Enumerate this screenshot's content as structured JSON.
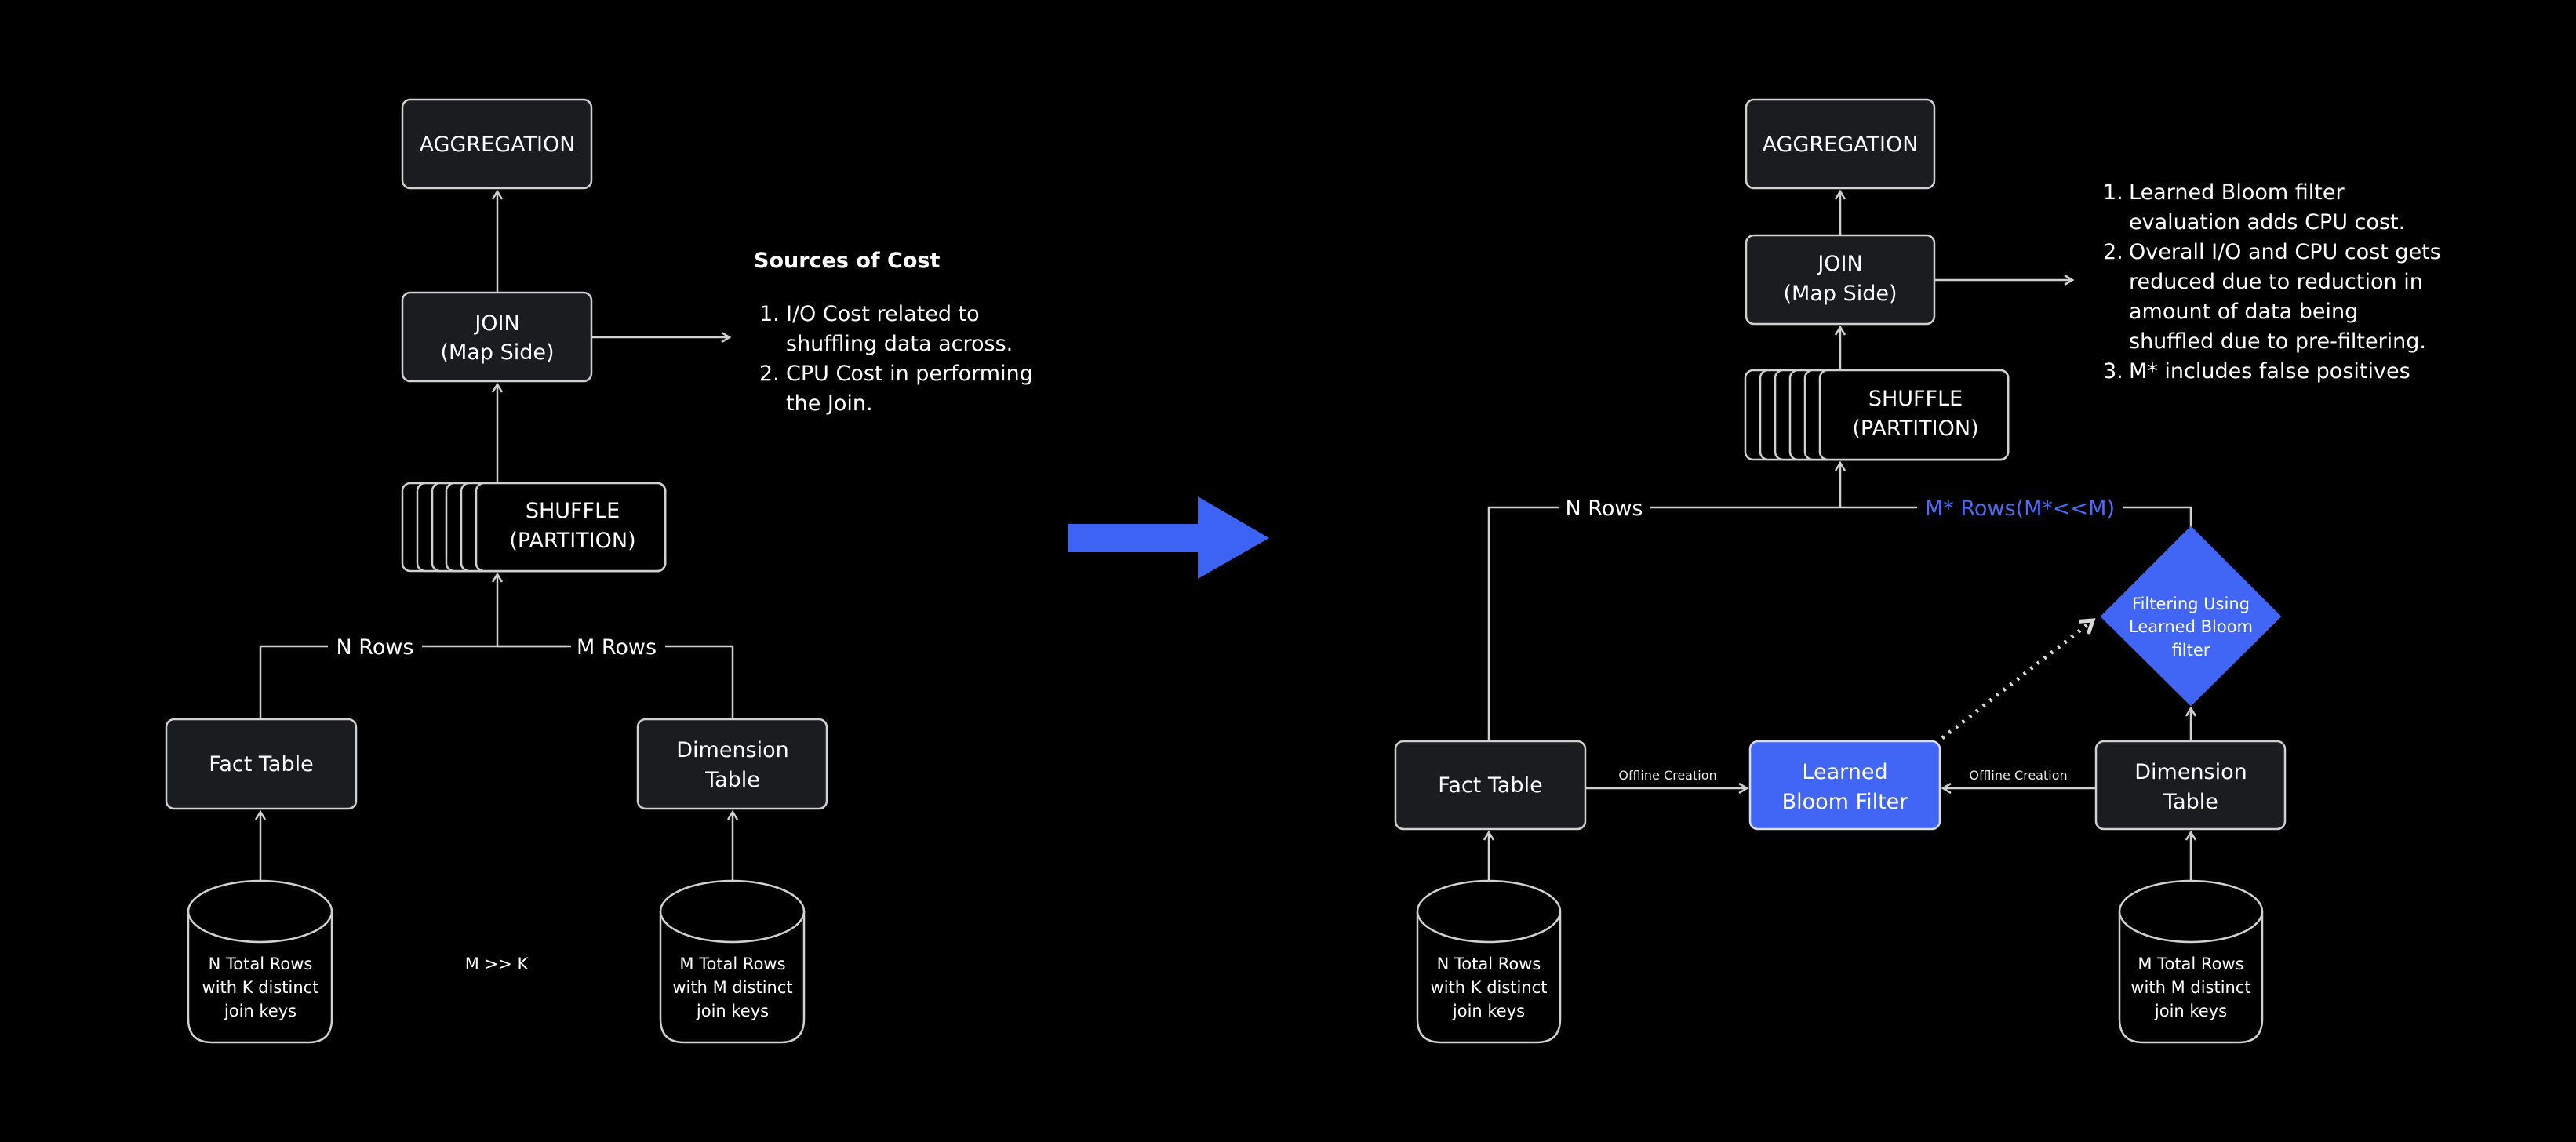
{
  "left_diagram": {
    "aggregation": "AGGREGATION",
    "join": {
      "line1": "JOIN",
      "line2": "(Map Side)"
    },
    "shuffle": {
      "line1": "SHUFFLE",
      "line2": "(PARTITION)"
    },
    "n_rows_label": "N Rows",
    "m_rows_label": "M Rows",
    "fact_table": "Fact Table",
    "dimension_table": {
      "line1": "Dimension",
      "line2": "Table"
    },
    "fact_source": [
      "N Total Rows",
      "with K distinct",
      "join keys"
    ],
    "dimension_source": [
      "M Total Rows",
      "with M distinct",
      "join keys"
    ],
    "relation_note": "M >> K",
    "cost_notes": {
      "heading": "Sources of Cost",
      "items": [
        {
          "num": "1.",
          "lines": [
            "I/O Cost related to",
            "shuffling data across."
          ]
        },
        {
          "num": "2.",
          "lines": [
            "CPU Cost in performing",
            "the Join."
          ]
        }
      ]
    }
  },
  "transition_arrow": {
    "color": "#3d63f5",
    "icon": "right-arrow-icon"
  },
  "right_diagram": {
    "aggregation": "AGGREGATION",
    "join": {
      "line1": "JOIN",
      "line2": "(Map Side)"
    },
    "shuffle": {
      "line1": "SHUFFLE",
      "line2": "(PARTITION)"
    },
    "n_rows_label": "N Rows",
    "m_star_rows_label": "M* Rows(M*<<M)",
    "fact_table": "Fact Table",
    "learned_bloom_filter": {
      "line1": "Learned",
      "line2": "Bloom Filter"
    },
    "dimension_table": {
      "line1": "Dimension",
      "line2": "Table"
    },
    "filter_node": [
      "Filtering Using",
      "Learned Bloom",
      "filter"
    ],
    "offline_creation_left": "Offline Creation",
    "offline_creation_right": "Offline Creation",
    "fact_source": [
      "N Total Rows",
      "with K distinct",
      "join keys"
    ],
    "dimension_source": [
      "M Total Rows",
      "with M distinct",
      "join keys"
    ],
    "cost_notes": {
      "items": [
        {
          "num": "1.",
          "lines": [
            "Learned Bloom filter",
            "evaluation adds CPU cost."
          ]
        },
        {
          "num": "2.",
          "lines": [
            "Overall I/O and CPU cost gets",
            "reduced due to reduction in",
            "amount of data being",
            "shuffled due to pre-filtering."
          ]
        },
        {
          "num": "3.",
          "lines": [
            "M* includes false positives"
          ]
        }
      ]
    }
  },
  "colors": {
    "background": "#000000",
    "node_fill": "#1b1c20",
    "accent_blue": "#4166f5",
    "line": "#d0d0d0"
  }
}
